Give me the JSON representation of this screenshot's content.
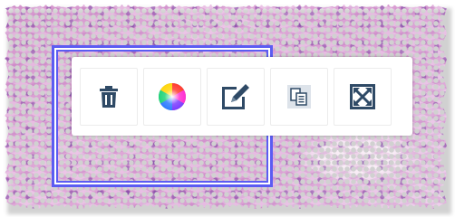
{
  "colors": {
    "selection_border": "#5b5cf2",
    "icon_dark": "#2f4a66",
    "toolbar_bg": "#ffffff"
  },
  "toolbar": {
    "buttons": [
      {
        "icon": "trash-icon",
        "tooltip": ""
      },
      {
        "icon": "color-wheel-icon",
        "tooltip": ""
      },
      {
        "icon": "edit-pen-icon",
        "tooltip": ""
      },
      {
        "icon": "copy-icon",
        "tooltip": ""
      },
      {
        "icon": "expand-arrows-icon",
        "tooltip": ""
      }
    ]
  }
}
